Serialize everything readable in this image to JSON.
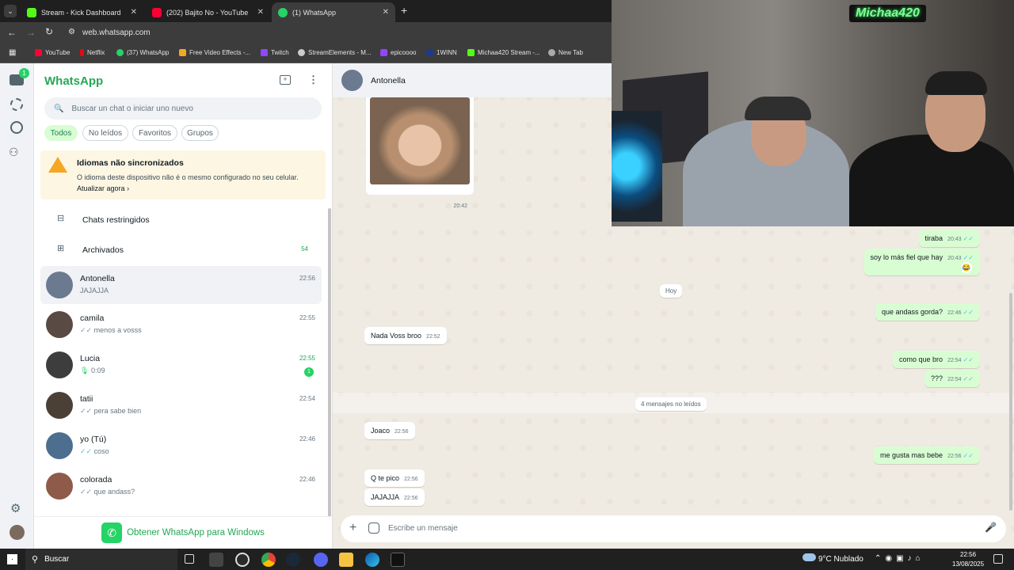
{
  "browser": {
    "tabs": [
      {
        "title": "Stream - Kick Dashboard",
        "favicon_color": "#53fc18"
      },
      {
        "title": "(202) Bajito No - YouTube",
        "favicon_color": "#ff0033"
      },
      {
        "title": "(1) WhatsApp",
        "favicon_color": "#25d366"
      }
    ],
    "url": "web.whatsapp.com",
    "bookmarks": [
      {
        "label": "YouTube",
        "color": "#ff0033"
      },
      {
        "label": "Netflix",
        "color": "#e50914"
      },
      {
        "label": "(37) WhatsApp",
        "color": "#25d366"
      },
      {
        "label": "Free Video Effects -...",
        "color": "#f5a623"
      },
      {
        "label": "Twitch",
        "color": "#9146ff"
      },
      {
        "label": "StreamElements - M...",
        "color": "#cccccc"
      },
      {
        "label": "epicoooo",
        "color": "#9146ff"
      },
      {
        "label": "1WINN",
        "color": "#1e3a8a"
      },
      {
        "label": "Michaa420 Stream -...",
        "color": "#53fc18"
      },
      {
        "label": "New Tab",
        "color": "#aaaaaa"
      }
    ]
  },
  "rail": {
    "unread_badge": "1"
  },
  "sidebar": {
    "title": "WhatsApp",
    "search_placeholder": "Buscar un chat o iniciar uno nuevo",
    "filters": [
      "Todos",
      "No leídos",
      "Favoritos",
      "Grupos"
    ],
    "banner": {
      "title": "Idiomas não sincronizados",
      "text": "O idioma deste dispositivo não é o mesmo configurado no seu celular.",
      "link": "Atualizar agora"
    },
    "restricted": "Chats restringidos",
    "archived": "Archivados",
    "archived_count": "54",
    "chats": [
      {
        "name": "Antonella",
        "preview": "JAJAJJA",
        "time": "22:56",
        "avatar": "#6b7a8f"
      },
      {
        "name": "camila",
        "preview": "menos a vosss",
        "time": "22:55",
        "avatar": "#5a4a44"
      },
      {
        "name": "Lucia",
        "preview": "0:09",
        "time": "22:55",
        "unread": "1",
        "avatar": "#3d3d3d"
      },
      {
        "name": "tatii",
        "preview": "pera sabe bien",
        "time": "22:54",
        "avatar": "#4a4036"
      },
      {
        "name": "yo (Tú)",
        "preview": "coso",
        "time": "22:46",
        "avatar": "#4d6e8e"
      },
      {
        "name": "colorada",
        "preview": "que andass?",
        "time": "22:46",
        "avatar": "#8e5a4a"
      }
    ],
    "get_app": "Obtener WhatsApp para Windows"
  },
  "chat": {
    "contact": "Antonella",
    "image_time": "20:42",
    "day_label": "Hoy",
    "unread_label": "4 mensajes no leídos",
    "composer_placeholder": "Escribe un mensaje",
    "messages": [
      {
        "text": "tiraba",
        "time": "20:43"
      },
      {
        "text": "soy lo más fiel que hay",
        "time": "20:43"
      },
      {
        "text": "que andass gorda?",
        "time": "22:46"
      },
      {
        "text": "Nada Voss broo",
        "time": "22:52"
      },
      {
        "text": "como que bro",
        "time": "22:54"
      },
      {
        "text": "???",
        "time": "22:54"
      },
      {
        "text": "Joaco",
        "time": "22:56"
      },
      {
        "text": "me gusta mas bebe",
        "time": "22:56"
      },
      {
        "text": "Q te pico",
        "time": "22:56"
      },
      {
        "text": "JAJAJJA",
        "time": "22:56"
      }
    ]
  },
  "webcam": {
    "overlay_name": "Michaa420"
  },
  "taskbar": {
    "search": "Buscar",
    "weather": "9°C Nublado",
    "time": "22:56",
    "date": "13/08/2025"
  }
}
